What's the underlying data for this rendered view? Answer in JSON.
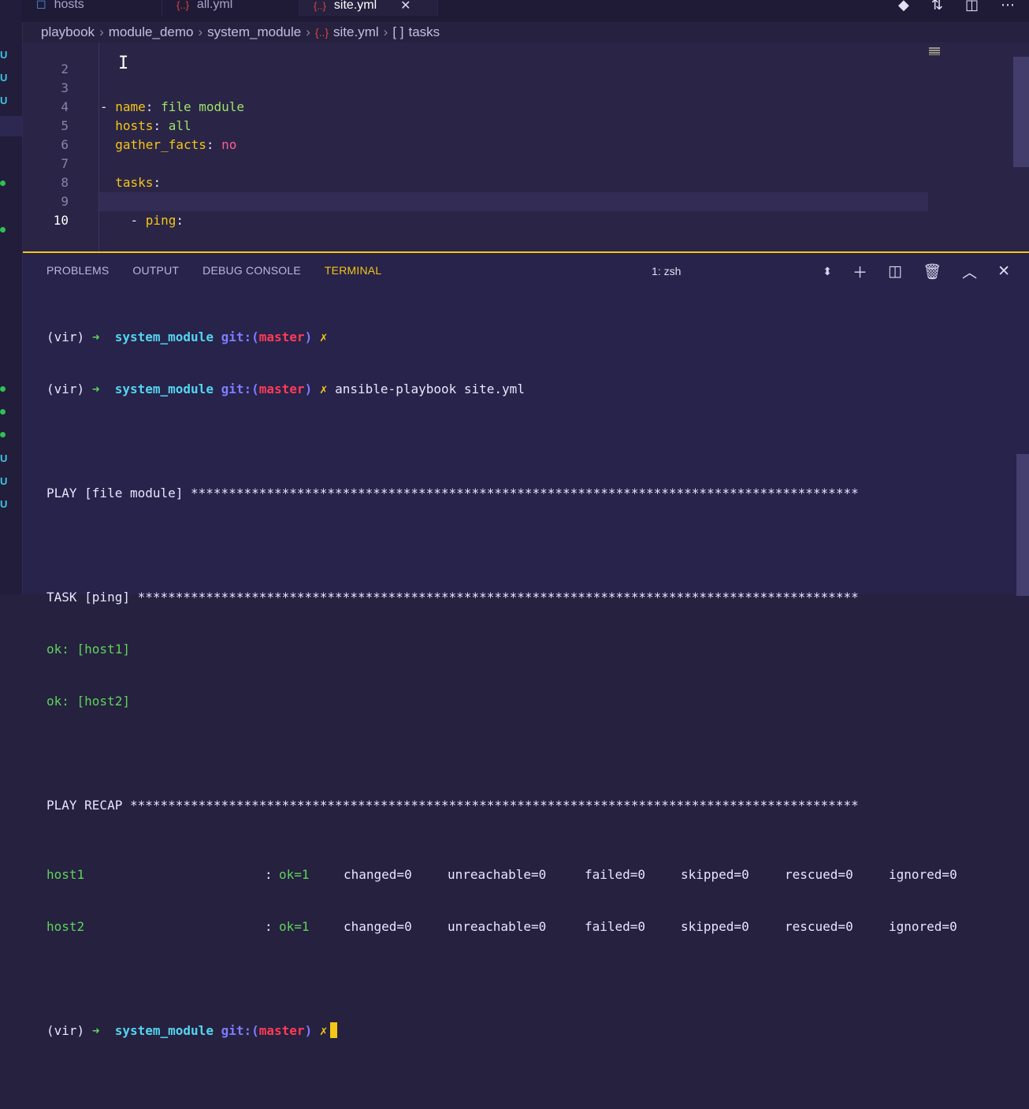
{
  "tabs": [
    {
      "label": "hosts",
      "icon": "file-icon"
    },
    {
      "label": "all.yml",
      "icon": "yaml-icon"
    },
    {
      "label": "site.yml",
      "icon": "yaml-icon",
      "active": true
    }
  ],
  "tab_close": "✕",
  "breadcrumb": {
    "parts": [
      "playbook",
      "module_demo",
      "system_module"
    ],
    "file_icon": "{..}",
    "file": "site.yml",
    "symbol_icon": "[ ]",
    "symbol": "tasks"
  },
  "editor": {
    "lines": [
      {
        "num": "2",
        "code": ""
      },
      {
        "num": "3",
        "code": "- name: file module"
      },
      {
        "num": "4",
        "code": "  hosts: all"
      },
      {
        "num": "5",
        "code": "  gather_facts: no"
      },
      {
        "num": "6",
        "code": ""
      },
      {
        "num": "7",
        "code": "  tasks:"
      },
      {
        "num": "8",
        "code": ""
      },
      {
        "num": "9",
        "code": "    - ping:"
      },
      {
        "num": "10",
        "code": ""
      }
    ],
    "tokens": {
      "l3_dash": "- ",
      "l3_key": "name",
      "l3_colon": ":",
      "l3_val": " file module",
      "l4_key": "hosts",
      "l4_colon": ":",
      "l4_val": " all",
      "l5_key": "gather_facts",
      "l5_colon": ":",
      "l5_val": " no",
      "l7_key": "tasks",
      "l7_colon": ":",
      "l9_dash": "- ",
      "l9_key": "ping",
      "l9_colon": ":"
    }
  },
  "panel": {
    "tabs": [
      "PROBLEMS",
      "OUTPUT",
      "DEBUG CONSOLE",
      "TERMINAL"
    ],
    "active_tab": "TERMINAL",
    "terminal_select": "1: zsh",
    "icons": [
      "select-arrows-icon",
      "plus-icon",
      "split-icon",
      "trash-icon",
      "chevron-up-icon",
      "close-icon"
    ]
  },
  "terminal": {
    "venv": "(vir)",
    "arrow": "➜",
    "dir": "system_module",
    "git": "git:(",
    "branch": "master",
    "git_close": ")",
    "dirty": "✗",
    "command": "ansible-playbook site.yml",
    "play_line": "PLAY [file module] ****************************************************************************************",
    "task_line": "TASK [ping] ***********************************************************************************************",
    "ok1": "ok: [host1]",
    "ok2": "ok: [host2]",
    "recap_line": "PLAY RECAP ************************************************************************************************",
    "recap": [
      {
        "host": "host1",
        "colon": ":",
        "ok": "ok=1",
        "changed": "changed=0",
        "unreachable": "unreachable=0",
        "failed": "failed=0",
        "skipped": "skipped=0",
        "rescued": "rescued=0",
        "ignored": "ignored=0"
      },
      {
        "host": "host2",
        "colon": ":",
        "ok": "ok=1",
        "changed": "changed=0",
        "unreachable": "unreachable=0",
        "failed": "failed=0",
        "skipped": "skipped=0",
        "rescued": "rescued=0",
        "ignored": "ignored=0"
      }
    ]
  },
  "side_badges": [
    "U",
    "U",
    "U",
    "U",
    "U",
    "U"
  ],
  "colors": {
    "accent": "#f5c518",
    "background": "#25213f",
    "terminal_green": "#5fd35c",
    "terminal_cyan": "#54d5f0",
    "terminal_red": "#ff3b57"
  }
}
